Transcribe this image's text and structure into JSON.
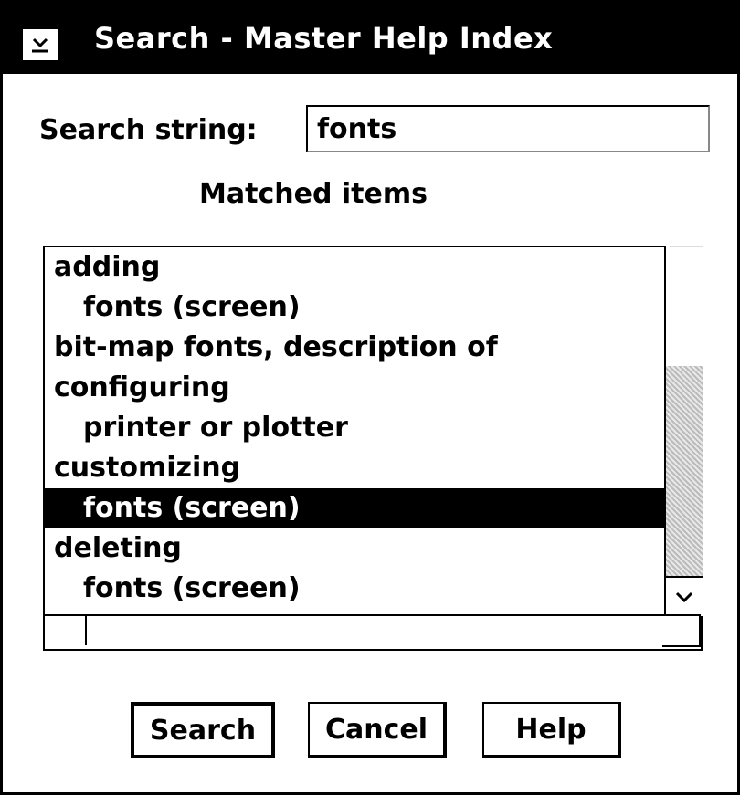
{
  "window": {
    "title": "Search - Master Help Index"
  },
  "icons": {
    "system_menu": "system-menu-icon",
    "scroll_down": "chevron-down-icon"
  },
  "search": {
    "label": "Search string:",
    "value": "fonts"
  },
  "matched": {
    "label": "Matched items",
    "items": [
      {
        "text": "adding",
        "indent": false,
        "selected": false
      },
      {
        "text": "fonts (screen)",
        "indent": true,
        "selected": false
      },
      {
        "text": "bit-map fonts, description of",
        "indent": false,
        "selected": false
      },
      {
        "text": "configuring",
        "indent": false,
        "selected": false
      },
      {
        "text": "printer or plotter",
        "indent": true,
        "selected": false
      },
      {
        "text": "customizing",
        "indent": false,
        "selected": false
      },
      {
        "text": "fonts (screen)",
        "indent": true,
        "selected": true
      },
      {
        "text": "deleting",
        "indent": false,
        "selected": false
      },
      {
        "text": "fonts (screen)",
        "indent": true,
        "selected": false
      }
    ]
  },
  "buttons": {
    "search": "Search",
    "cancel": "Cancel",
    "help": "Help"
  }
}
